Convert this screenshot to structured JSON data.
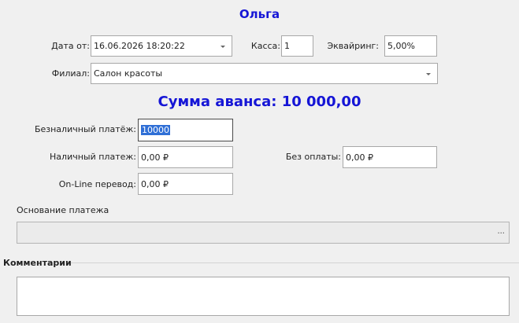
{
  "client_name": "Ольга",
  "date_from": {
    "label": "Дата от:",
    "value": "16.06.2026 18:20:22"
  },
  "kassa": {
    "label": "Касса:",
    "value": "1"
  },
  "acquiring": {
    "label": "Эквайринг:",
    "value": "5,00%"
  },
  "branch": {
    "label": "Филиал:",
    "value": "Салон красоты"
  },
  "advance_sum": "Сумма аванса: 10 000,00",
  "cashless": {
    "label": "Безналичный платёж:",
    "value": "10000"
  },
  "cash": {
    "label": "Наличный платеж:",
    "value": "0,00 ₽"
  },
  "no_payment": {
    "label": "Без оплаты:",
    "value": "0,00 ₽"
  },
  "online": {
    "label": "On-Line перевод:",
    "value": "0,00 ₽"
  },
  "basis": {
    "label": "Основание платежа",
    "value": "",
    "button": "..."
  },
  "comments": {
    "label": "Комментарии",
    "value": ""
  },
  "colors": {
    "accent": "#1515d6",
    "selection": "#2f6fd6",
    "background": "#f0f0f0"
  }
}
